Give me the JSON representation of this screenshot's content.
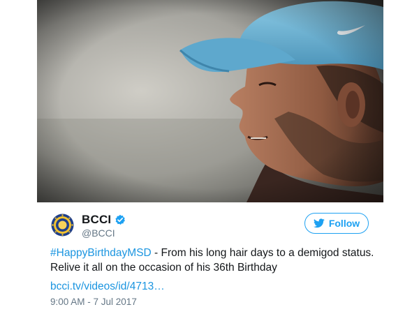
{
  "tweet": {
    "media": {
      "description_icon": "photo-icon"
    },
    "author": {
      "display_name": "BCCI",
      "handle": "@BCCI",
      "verified": true
    },
    "follow_label": "Follow",
    "text": {
      "hashtag": "#HappyBirthdayMSD",
      "body": " - From his long hair days to a demigod status. Relive it all on the occasion of his 36th Birthday",
      "link": "bcci.tv/videos/id/4713…"
    },
    "timestamp": "9:00 AM - 7 Jul 2017"
  },
  "colors": {
    "link_blue": "#1b95e0",
    "follow_blue": "#1da1f2",
    "cap_blue": "#6fb5d6"
  }
}
